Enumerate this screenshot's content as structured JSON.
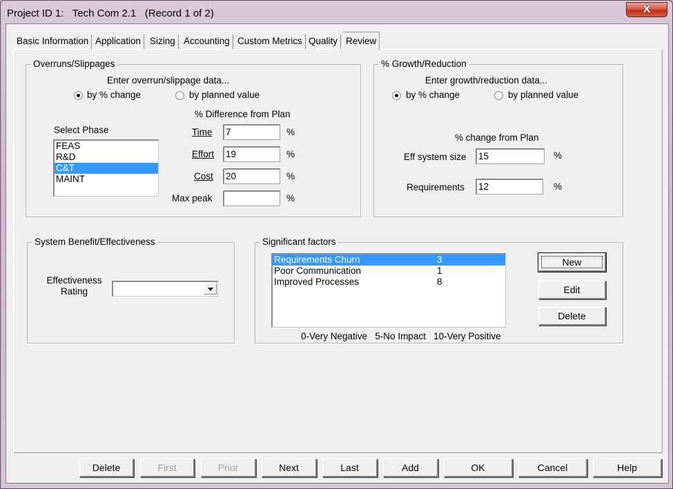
{
  "window": {
    "title": "Project ID 1:   Tech Com 2.1   (Record 1 of 2)",
    "close_label": "X"
  },
  "tabs": [
    {
      "label": "Basic Information",
      "active": false
    },
    {
      "label": "Application",
      "active": false
    },
    {
      "label": "Sizing",
      "active": false
    },
    {
      "label": "Accounting",
      "active": false
    },
    {
      "label": "Custom Metrics",
      "active": false
    },
    {
      "label": "Quality",
      "active": false
    },
    {
      "label": "Review",
      "active": true
    }
  ],
  "overruns": {
    "title": "Overruns/Slippages",
    "prompt": "Enter overrun/slippage data...",
    "radio_pct": {
      "label": "by % change",
      "checked": true
    },
    "radio_planned": {
      "label": "by planned value",
      "checked": false
    },
    "phase_label": "Select Phase",
    "phases": [
      "FEAS",
      "R&D",
      "C&T",
      "MAINT"
    ],
    "selected_phase": "C&T",
    "diff_header": "% Difference from Plan",
    "fields": [
      {
        "label": "Time",
        "value": "7",
        "unit": "%"
      },
      {
        "label": "Effort",
        "value": "19",
        "unit": "%"
      },
      {
        "label": "Cost",
        "value": "20",
        "unit": "%"
      },
      {
        "label": "Max peak",
        "value": "",
        "unit": "%"
      }
    ]
  },
  "growth": {
    "title": "% Growth/Reduction",
    "prompt": "Enter growth/reduction data...",
    "radio_pct": {
      "label": "by % change",
      "checked": true
    },
    "radio_planned": {
      "label": "by planned value",
      "checked": false
    },
    "change_header": "% change from Plan",
    "fields": [
      {
        "label": "Eff system size",
        "value": "15",
        "unit": "%"
      },
      {
        "label": "Requirements",
        "value": "12",
        "unit": "%"
      }
    ]
  },
  "benefit": {
    "title": "System Benefit/Effectiveness",
    "rating_label_line1": "Effectiveness",
    "rating_label_line2": "Rating",
    "rating_value": ""
  },
  "factors": {
    "title": "Significant factors",
    "items": [
      {
        "name": "Requirements Churn",
        "score": "3",
        "selected": true
      },
      {
        "name": "Poor Communication",
        "score": "1",
        "selected": false
      },
      {
        "name": "Improved Processes",
        "score": "8",
        "selected": false
      }
    ],
    "legend": "0-Very Negative   5-No Impact   10-Very Positive",
    "new_label": "New",
    "edit_label": "Edit",
    "delete_label": "Delete"
  },
  "footer": {
    "delete": "Delete",
    "first": "First",
    "prior": "Prior",
    "next": "Next",
    "last": "Last",
    "add": "Add",
    "ok": "OK",
    "cancel": "Cancel",
    "help": "Help"
  }
}
